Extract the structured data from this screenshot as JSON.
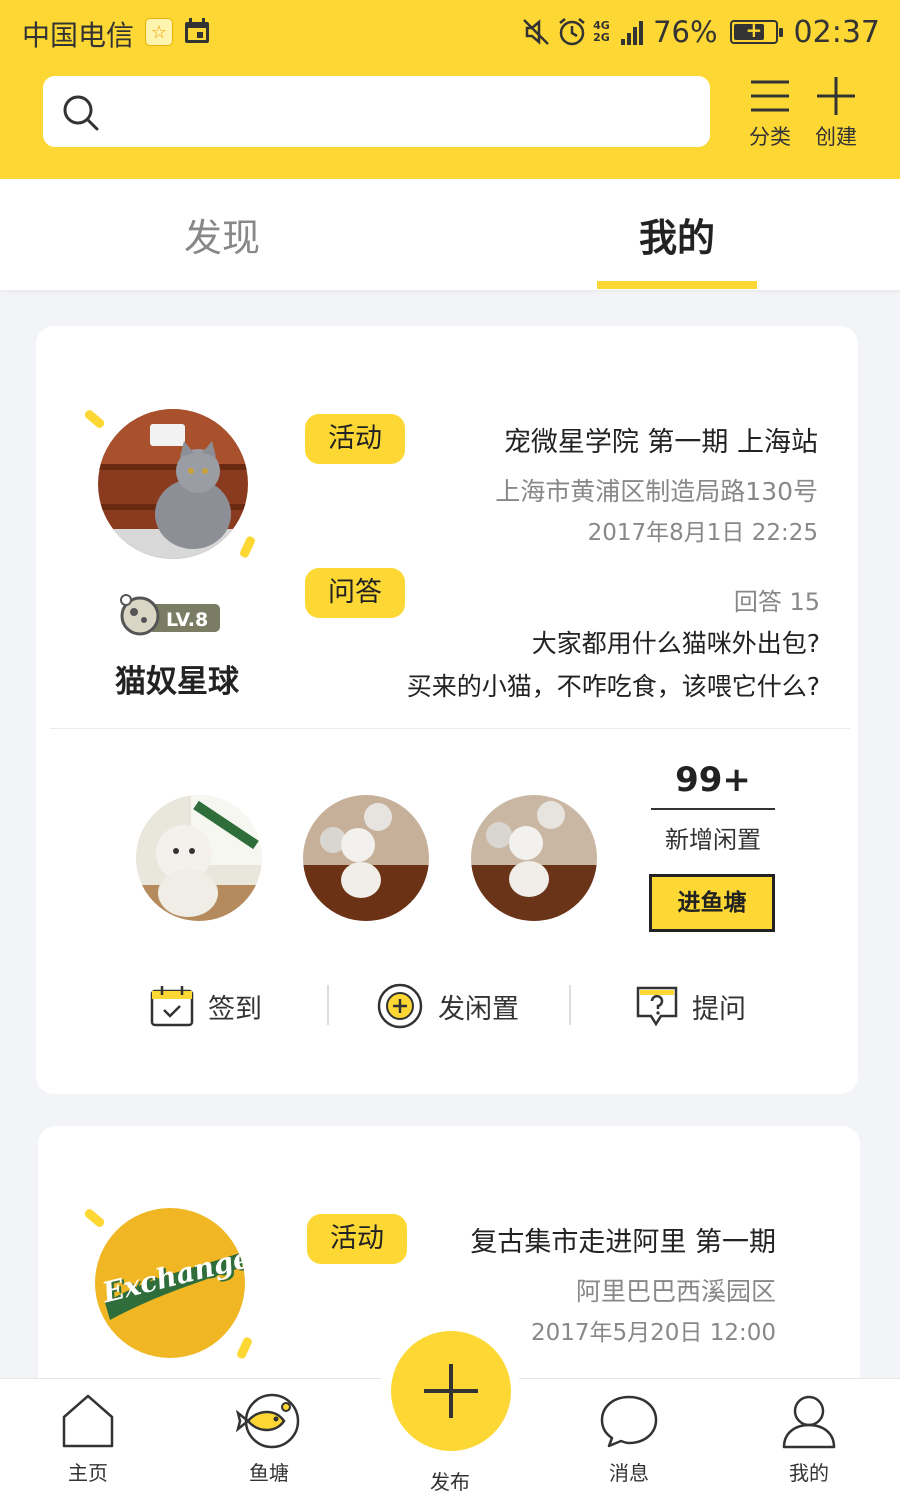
{
  "status_bar": {
    "carrier": "中国电信",
    "network": "4G 2G",
    "battery_pct": "76%",
    "battery_level": 0.76,
    "time": "02:37"
  },
  "header": {
    "search_placeholder": "",
    "category_label": "分类",
    "create_label": "创建",
    "accent_color": "#fdd835"
  },
  "tabs": {
    "discover": "发现",
    "mine": "我的",
    "active": "mine"
  },
  "card1": {
    "pond_name": "猫奴星球",
    "level": "LV.8",
    "activity": {
      "tag": "活动",
      "title": "宠微星学院 第一期 上海站",
      "address": "上海市黄浦区制造局路130号",
      "datetime": "2017年8月1日  22:25"
    },
    "qa": {
      "tag": "问答",
      "answers": "回答 15",
      "questions": [
        "大家都用什么猫咪外出包?",
        "买来的小猫，不咋吃食，该喂它什么?"
      ]
    },
    "stats": {
      "count": "99+",
      "count_label": "新增闲置",
      "enter_button": "进鱼塘"
    },
    "actions": {
      "checkin": "签到",
      "post_idle": "发闲置",
      "ask": "提问"
    }
  },
  "card2": {
    "logo_text": "Exchange",
    "activity": {
      "tag": "活动",
      "title": "复古集市走进阿里 第一期",
      "address": "阿里巴巴西溪园区",
      "datetime": "2017年5月20日  12:00"
    }
  },
  "bottom_nav": {
    "home": "主页",
    "pond": "鱼塘",
    "publish": "发布",
    "messages": "消息",
    "mine": "我的"
  }
}
